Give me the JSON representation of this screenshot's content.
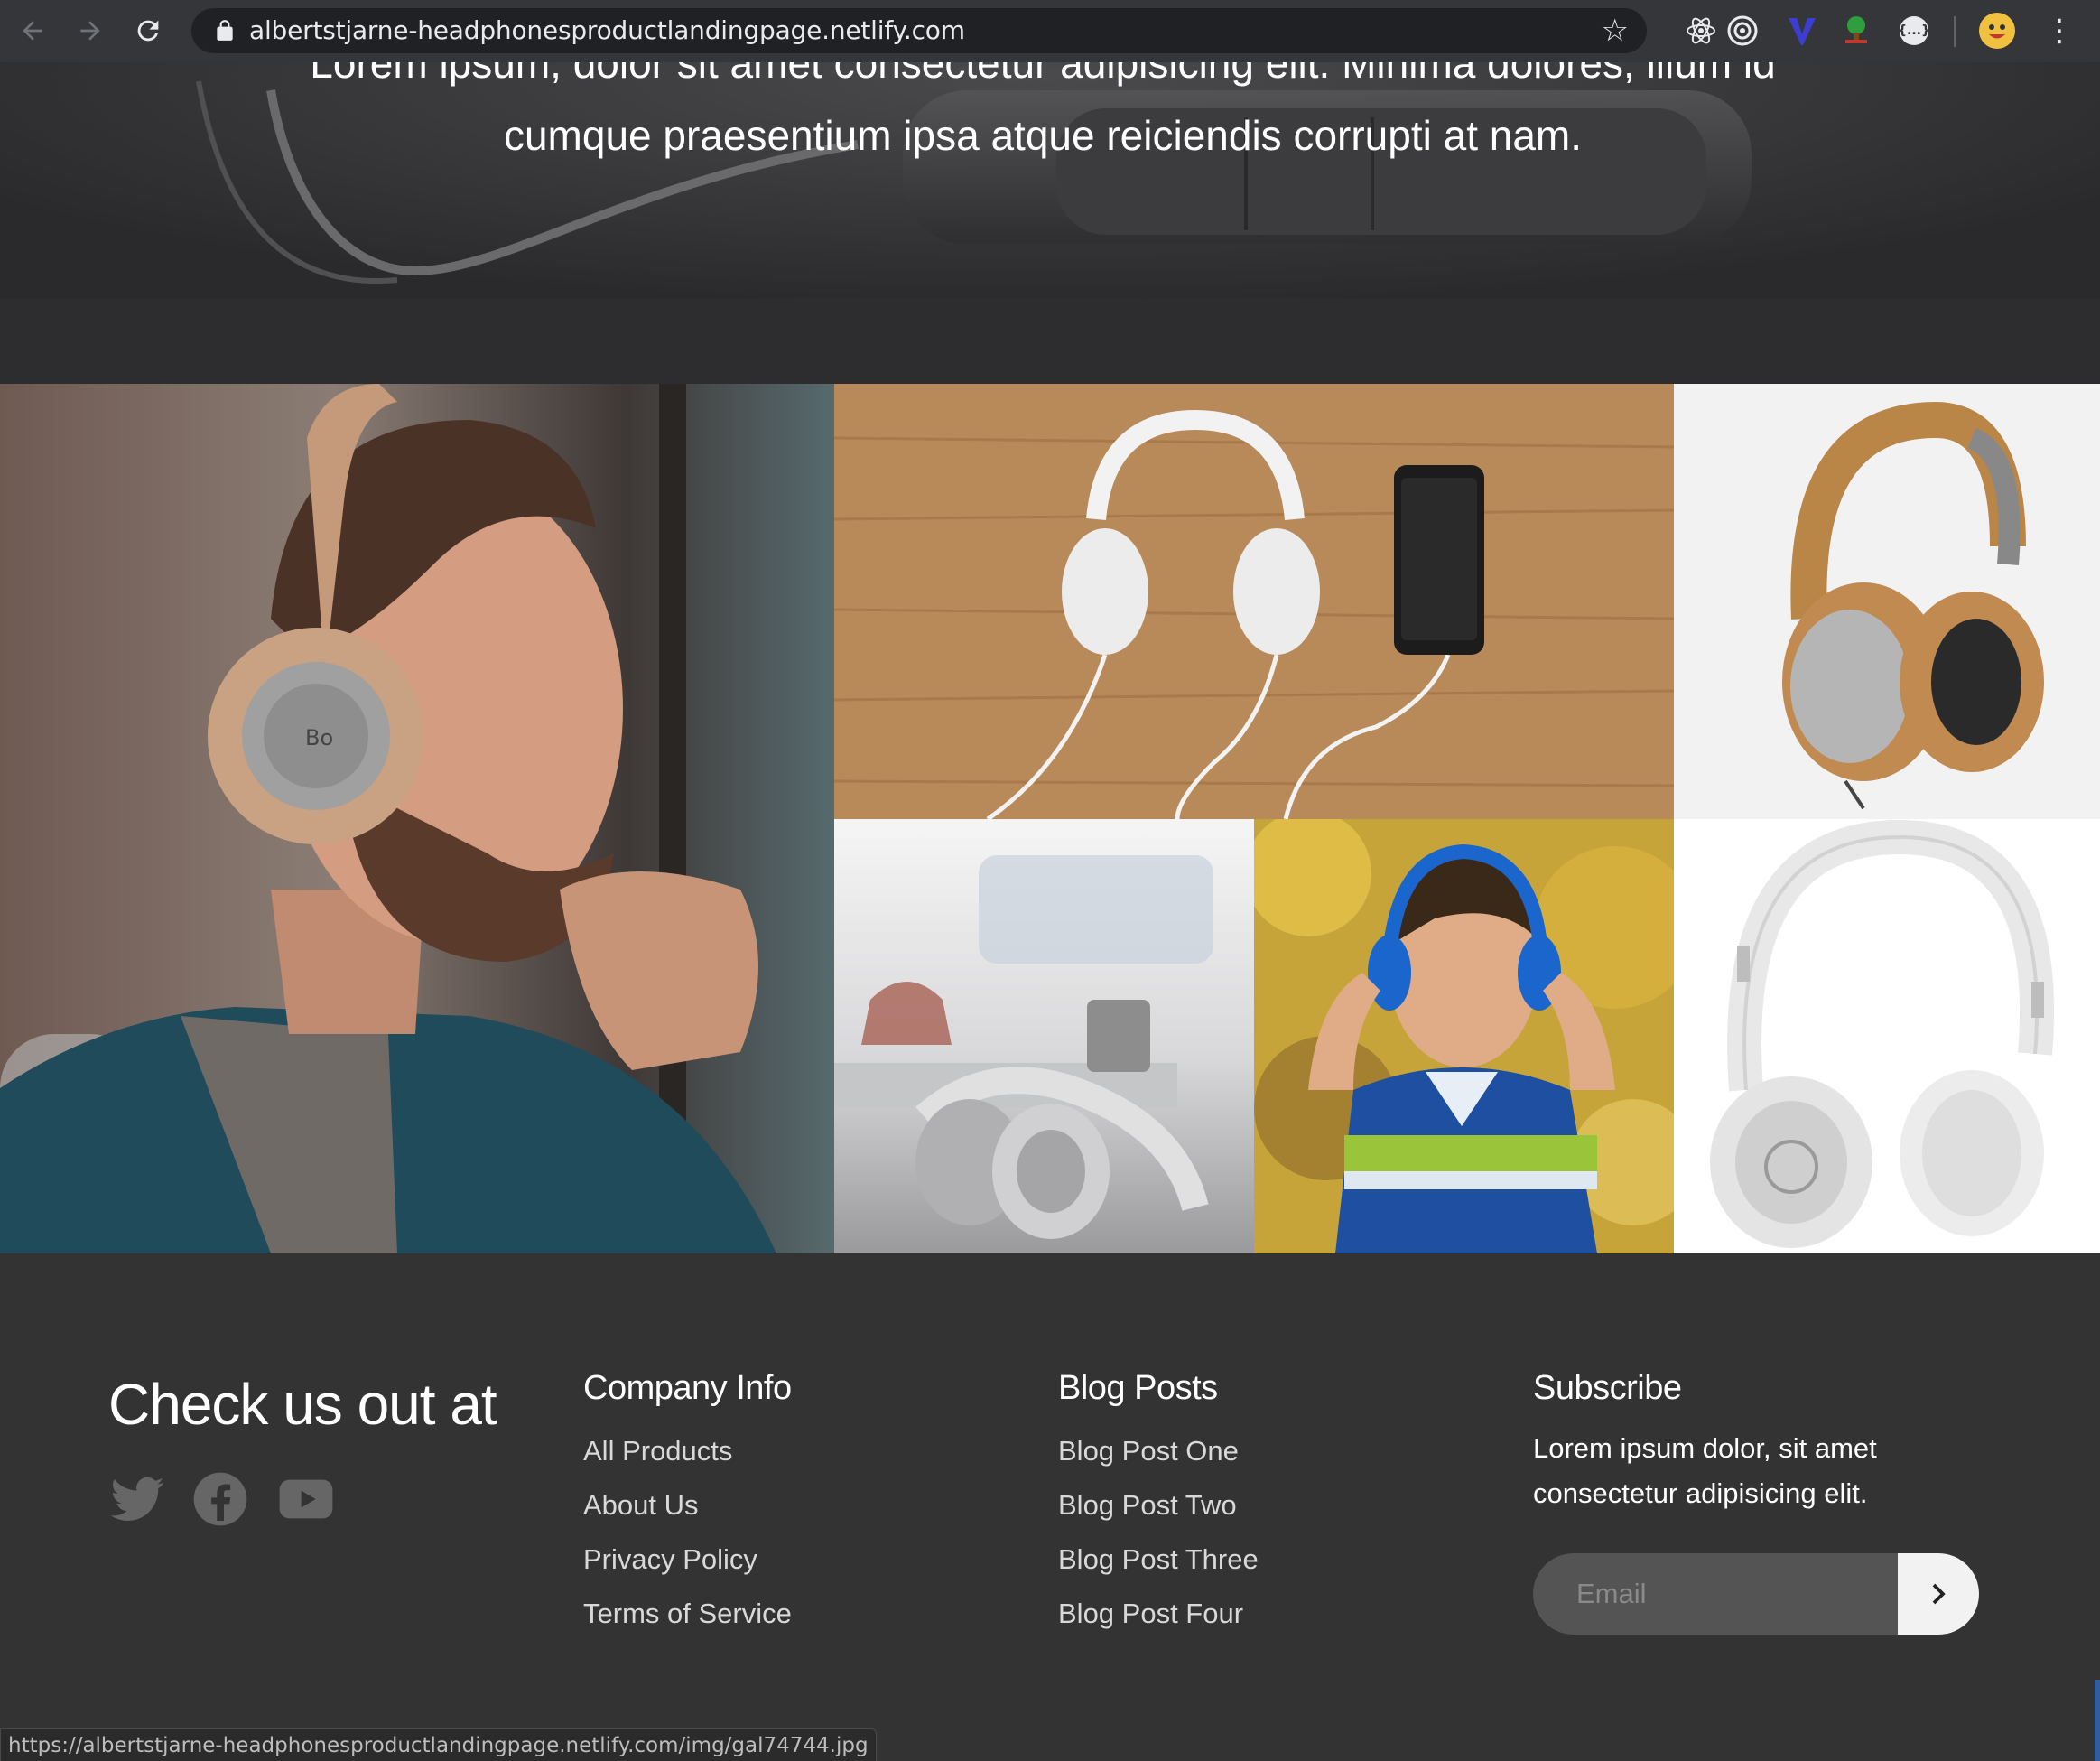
{
  "browser": {
    "url": "albertstjarne-headphonesproductlandingpage.netlify.com",
    "status_url": "https://albertstjarne-headphonesproductlandingpage.netlify.com/img/gal74744.jpg",
    "icons": [
      "back-arrow-icon",
      "forward-arrow-icon",
      "reload-icon",
      "lock-icon",
      "star-icon",
      "react-devtools-icon",
      "target-icon",
      "vue-icon",
      "tree-icon",
      "json-icon",
      "profile-avatar-icon",
      "more-menu-icon"
    ]
  },
  "hero": {
    "text_line1": "Lorem ipsum, dolor sit amet consectetur adipisicing elit. Minima dolores, illum id",
    "text_line2": "cumque praesentium ipsa atque reiciendis corrupti at nam."
  },
  "gallery": {
    "images": [
      "man-with-headphones",
      "white-headphones-on-wood",
      "tan-headphones",
      "headphones-on-desk",
      "boy-with-headphones",
      "white-beats-headphones"
    ]
  },
  "footer": {
    "title": "Check us out at",
    "socials": [
      "twitter-icon",
      "facebook-icon",
      "youtube-icon"
    ],
    "company": {
      "heading": "Company Info",
      "links": [
        "All Products",
        "About Us",
        "Privacy Policy",
        "Terms of Service"
      ]
    },
    "blog": {
      "heading": "Blog Posts",
      "links": [
        "Blog Post One",
        "Blog Post Two",
        "Blog Post Three",
        "Blog Post Four"
      ]
    },
    "subscribe": {
      "heading": "Subscribe",
      "text": "Lorem ipsum dolor, sit amet consectetur adipisicing elit.",
      "placeholder": "Email",
      "button_icon": "chevron-right-icon"
    }
  }
}
